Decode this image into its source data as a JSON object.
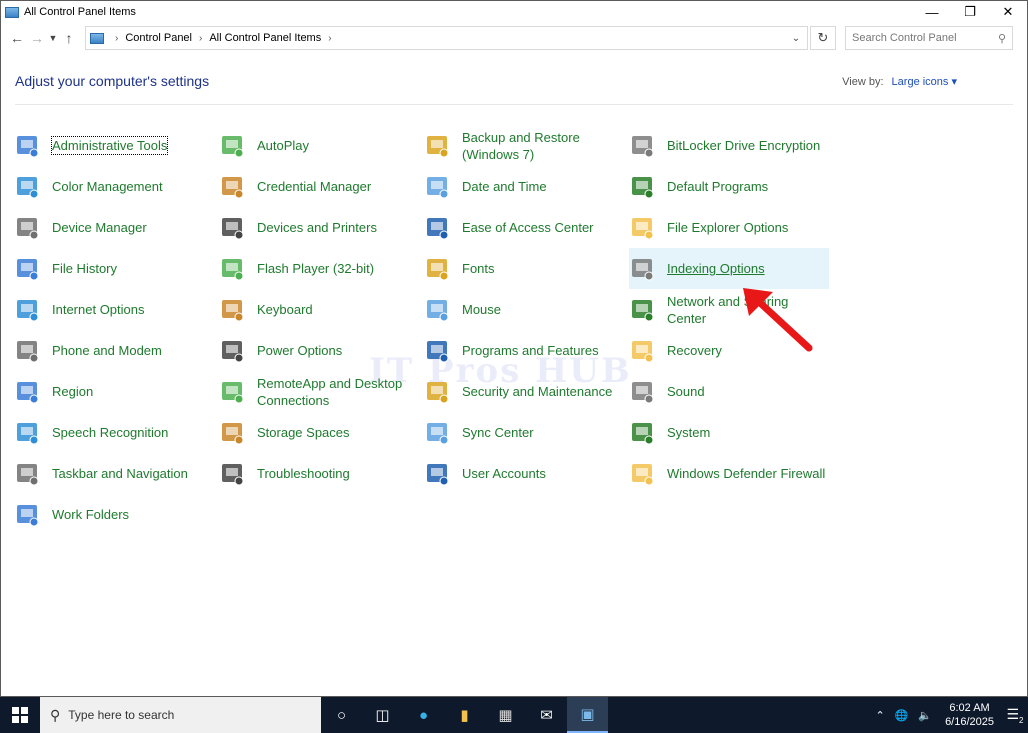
{
  "window": {
    "title": "All Control Panel Items"
  },
  "address": {
    "crumbs": [
      "Control Panel",
      "All Control Panel Items"
    ]
  },
  "search": {
    "placeholder": "Search Control Panel"
  },
  "header": {
    "title": "Adjust your computer's settings",
    "view_by_label": "View by:",
    "view_by_value": "Large icons"
  },
  "watermark": "IT Pros HUB",
  "items": [
    {
      "label": "Administrative Tools",
      "icon": "admin-tools-icon"
    },
    {
      "label": "AutoPlay",
      "icon": "autoplay-icon"
    },
    {
      "label": "Backup and Restore (Windows 7)",
      "icon": "backup-icon"
    },
    {
      "label": "BitLocker Drive Encryption",
      "icon": "bitlocker-icon"
    },
    {
      "label": "Color Management",
      "icon": "color-management-icon"
    },
    {
      "label": "Credential Manager",
      "icon": "credential-icon"
    },
    {
      "label": "Date and Time",
      "icon": "date-time-icon"
    },
    {
      "label": "Default Programs",
      "icon": "default-programs-icon"
    },
    {
      "label": "Device Manager",
      "icon": "device-manager-icon"
    },
    {
      "label": "Devices and Printers",
      "icon": "printer-icon"
    },
    {
      "label": "Ease of Access Center",
      "icon": "ease-access-icon"
    },
    {
      "label": "File Explorer Options",
      "icon": "folder-options-icon"
    },
    {
      "label": "File History",
      "icon": "file-history-icon"
    },
    {
      "label": "Flash Player (32-bit)",
      "icon": "flash-icon"
    },
    {
      "label": "Fonts",
      "icon": "fonts-icon"
    },
    {
      "label": "Indexing Options",
      "icon": "indexing-icon"
    },
    {
      "label": "Internet Options",
      "icon": "internet-icon"
    },
    {
      "label": "Keyboard",
      "icon": "keyboard-icon"
    },
    {
      "label": "Mouse",
      "icon": "mouse-icon"
    },
    {
      "label": "Network and Sharing Center",
      "icon": "network-icon"
    },
    {
      "label": "Phone and Modem",
      "icon": "phone-icon"
    },
    {
      "label": "Power Options",
      "icon": "power-icon"
    },
    {
      "label": "Programs and Features",
      "icon": "programs-icon"
    },
    {
      "label": "Recovery",
      "icon": "recovery-icon"
    },
    {
      "label": "Region",
      "icon": "region-icon"
    },
    {
      "label": "RemoteApp and Desktop Connections",
      "icon": "remoteapp-icon"
    },
    {
      "label": "Security and Maintenance",
      "icon": "flag-icon"
    },
    {
      "label": "Sound",
      "icon": "speaker-icon"
    },
    {
      "label": "Speech Recognition",
      "icon": "microphone-icon"
    },
    {
      "label": "Storage Spaces",
      "icon": "storage-icon"
    },
    {
      "label": "Sync Center",
      "icon": "sync-icon"
    },
    {
      "label": "System",
      "icon": "system-icon"
    },
    {
      "label": "Taskbar and Navigation",
      "icon": "taskbar-icon"
    },
    {
      "label": "Troubleshooting",
      "icon": "troubleshoot-icon"
    },
    {
      "label": "User Accounts",
      "icon": "users-icon"
    },
    {
      "label": "Windows Defender Firewall",
      "icon": "firewall-icon"
    },
    {
      "label": "Work Folders",
      "icon": "work-folders-icon"
    }
  ],
  "taskbar": {
    "search_placeholder": "Type here to search",
    "time": "6:02 AM",
    "date": "6/16/2025",
    "notifications": "2"
  },
  "colors": {
    "link": "#1f7a2e",
    "header": "#1e3287",
    "highlight": "#e5f3fb",
    "taskbar": "#0e1a2b"
  }
}
